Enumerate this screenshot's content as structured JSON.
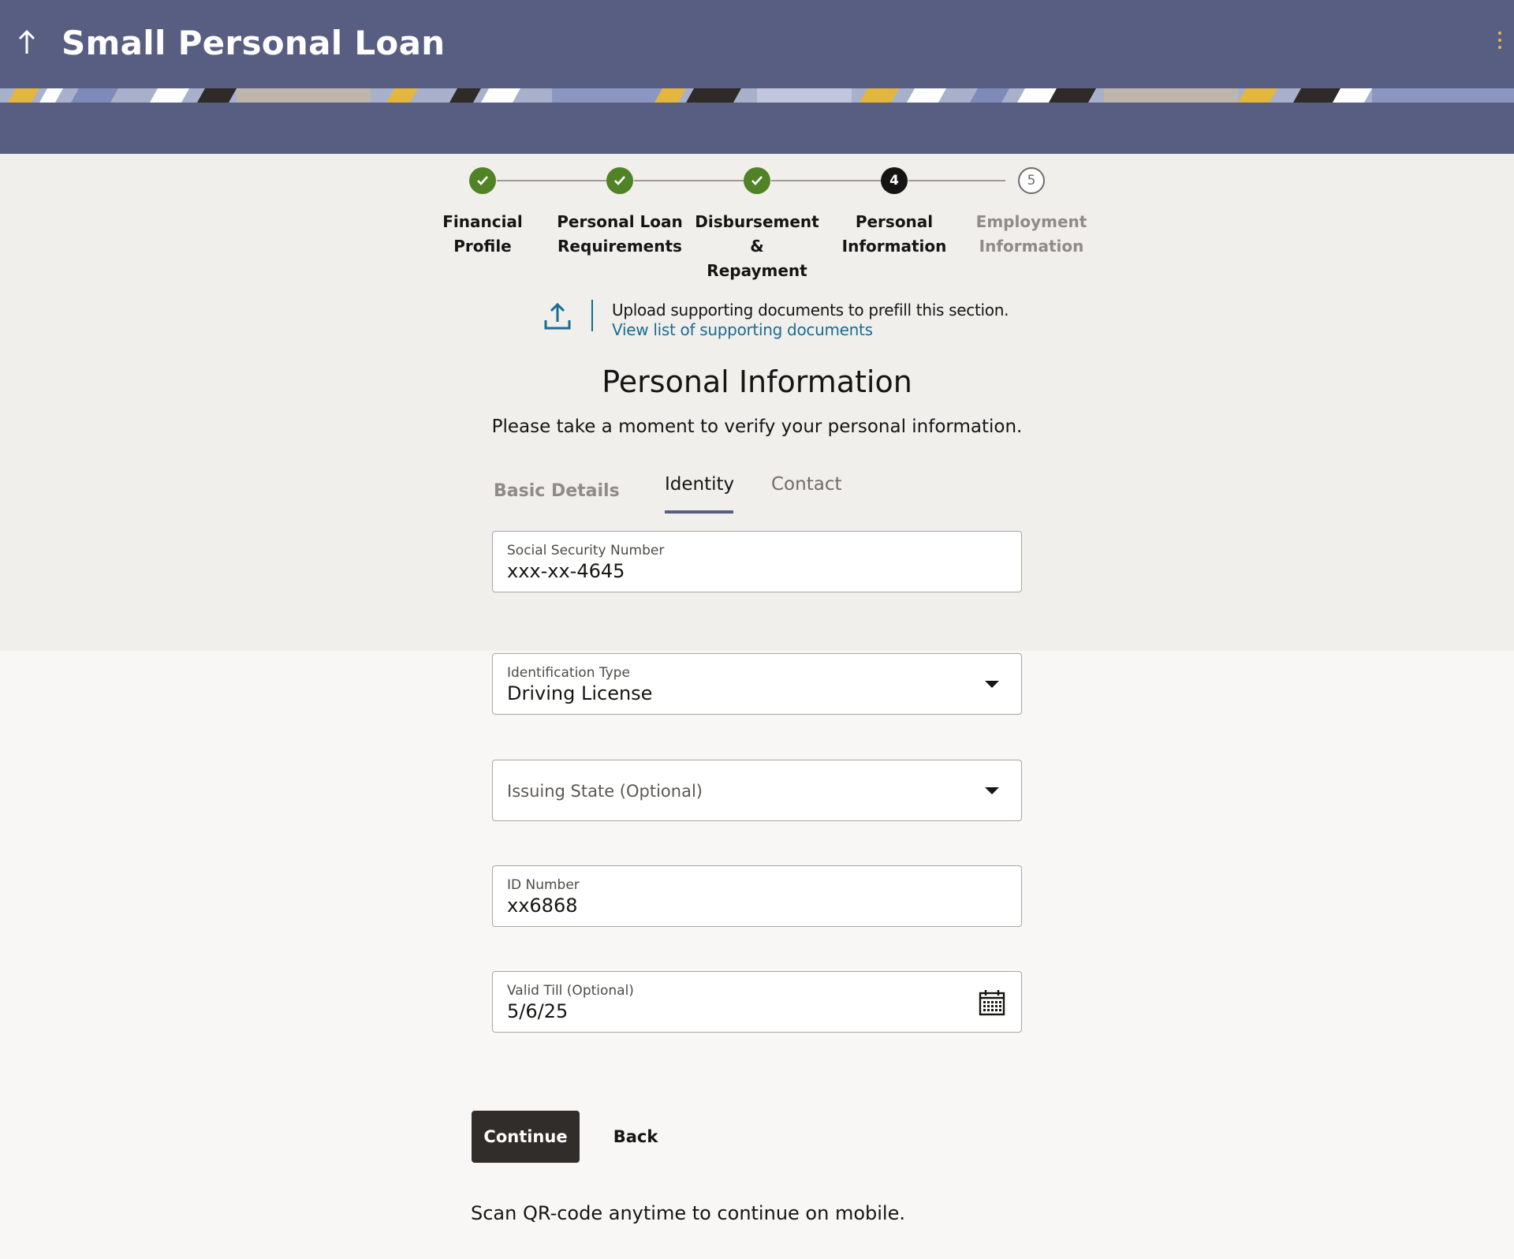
{
  "header": {
    "title": "Small Personal Loan",
    "back_icon": "up-arrow-icon",
    "menu_icon": "kebab-menu-icon",
    "background_color": "#585d82"
  },
  "stepper": {
    "steps": [
      {
        "label_line1": "Financial Profile",
        "label_line2": "",
        "status": "complete",
        "marker": ""
      },
      {
        "label_line1": "Personal Loan",
        "label_line2": "Requirements",
        "status": "complete",
        "marker": ""
      },
      {
        "label_line1": "Disbursement &",
        "label_line2": "Repayment",
        "status": "complete",
        "marker": ""
      },
      {
        "label_line1": "Personal",
        "label_line2": "Information",
        "status": "current",
        "marker": "4"
      },
      {
        "label_line1": "Employment",
        "label_line2": "Information",
        "status": "upcoming",
        "marker": "5"
      }
    ],
    "complete_color": "#508226"
  },
  "upload": {
    "text": "Upload supporting documents to prefill this section.",
    "link": "View list of supporting documents",
    "icon": "upload-icon"
  },
  "section": {
    "title": "Personal Information",
    "subtitle": "Please take a moment to verify your personal information."
  },
  "tabs": [
    {
      "label": "Basic Details",
      "state": "disabled"
    },
    {
      "label": "Identity",
      "state": "active"
    },
    {
      "label": "Contact",
      "state": "inactive"
    }
  ],
  "form": {
    "ssn": {
      "label": "Social Security Number",
      "value": "xxx-xx-4645"
    },
    "id_type": {
      "label": "Identification Type",
      "value": "Driving License"
    },
    "issuing_state": {
      "placeholder": "Issuing State (Optional)"
    },
    "id_number": {
      "label": "ID Number",
      "value": "xx6868"
    },
    "valid_till": {
      "label": "Valid Till (Optional)",
      "value": "5/6/25"
    }
  },
  "actions": {
    "continue": "Continue",
    "back": "Back"
  },
  "footer": {
    "qr_text": "Scan QR-code anytime to continue on mobile."
  }
}
